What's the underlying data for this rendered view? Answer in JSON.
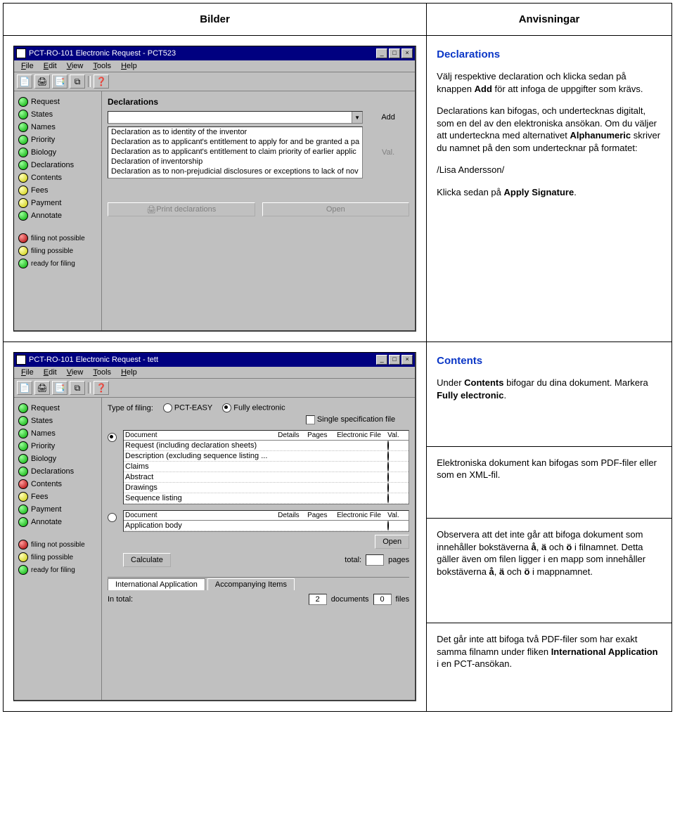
{
  "header": {
    "left": "Bilder",
    "right": "Anvisningar"
  },
  "screenshot1": {
    "title": "PCT-RO-101 Electronic Request - PCT523",
    "menu": [
      "File",
      "Edit",
      "View",
      "Tools",
      "Help"
    ],
    "toolbar_icons": [
      "new-icon",
      "open-icon",
      "print-icon",
      "duplicate-icon",
      "spacer",
      "help-icon"
    ],
    "sidebar": [
      {
        "color": "green",
        "label": "Request"
      },
      {
        "color": "green",
        "label": "States"
      },
      {
        "color": "green",
        "label": "Names"
      },
      {
        "color": "green",
        "label": "Priority"
      },
      {
        "color": "green",
        "label": "Biology"
      },
      {
        "color": "green",
        "label": "Declarations"
      },
      {
        "color": "yellow",
        "label": "Contents"
      },
      {
        "color": "yellow",
        "label": "Fees"
      },
      {
        "color": "yellow",
        "label": "Payment"
      },
      {
        "color": "green",
        "label": "Annotate"
      }
    ],
    "legend": [
      {
        "color": "red",
        "label": "filing not possible"
      },
      {
        "color": "yellow",
        "label": "filing possible"
      },
      {
        "color": "green",
        "label": "ready for filing"
      }
    ],
    "pane_title": "Declarations",
    "combo_value": "",
    "add_btn": "Add",
    "val_btn": "Val.",
    "decl_list": [
      "Declaration as to identity of the inventor",
      "Declaration as to applicant's entitlement to apply for and be granted a pa",
      "Declaration as to applicant's entitlement to claim priority of earlier applic",
      "Declaration of inventorship",
      "Declaration as to non-prejudicial disclosures or exceptions to lack of nov"
    ],
    "print_btn": "Print declarations",
    "open_btn": "Open"
  },
  "instr1": {
    "title": "Declarations",
    "p1a": "Välj respektive declaration och klicka sedan på knappen ",
    "p1b": "Add",
    "p1c": " för att infoga de uppgifter som krävs.",
    "p2a": "Declarations kan bifogas, och undertecknas digitalt, som en del av den elektroniska ansökan. Om du väljer att underteckna med alternativet ",
    "p2b": "Alphanumeric",
    "p2c": " skriver du namnet på den som undertecknar på formatet:",
    "sig": "/Lisa Andersson/",
    "p3a": "Klicka sedan på ",
    "p3b": "Apply Signature",
    "p3c": "."
  },
  "screenshot2": {
    "title": "PCT-RO-101 Electronic Request - tett",
    "menu": [
      "File",
      "Edit",
      "View",
      "Tools",
      "Help"
    ],
    "sidebar": [
      {
        "color": "green",
        "label": "Request"
      },
      {
        "color": "green",
        "label": "States"
      },
      {
        "color": "green",
        "label": "Names"
      },
      {
        "color": "green",
        "label": "Priority"
      },
      {
        "color": "green",
        "label": "Biology"
      },
      {
        "color": "green",
        "label": "Declarations"
      },
      {
        "color": "red",
        "label": "Contents"
      },
      {
        "color": "yellow",
        "label": "Fees"
      },
      {
        "color": "green",
        "label": "Payment"
      },
      {
        "color": "green",
        "label": "Annotate"
      }
    ],
    "legend": [
      {
        "color": "red",
        "label": "filing not possible"
      },
      {
        "color": "yellow",
        "label": "filing possible"
      },
      {
        "color": "green",
        "label": "ready for filing"
      }
    ],
    "filing_type_label": "Type of filing:",
    "filing_pcteasy": "PCT-EASY",
    "filing_fully": "Fully electronic",
    "single_spec": "Single specification file",
    "headers": [
      "Document",
      "Details",
      "Pages",
      "Electronic File",
      "Val."
    ],
    "docs1": [
      {
        "name": "Request (including declaration sheets)",
        "val": "green"
      },
      {
        "name": "Description (excluding sequence listing ...",
        "val": "red"
      },
      {
        "name": "Claims",
        "val": "red"
      },
      {
        "name": "Abstract",
        "val": "yellow"
      },
      {
        "name": "Drawings",
        "val": "grey"
      },
      {
        "name": "Sequence listing",
        "val": "grey"
      }
    ],
    "docs2": [
      {
        "name": "Application body",
        "val": "red"
      }
    ],
    "open_btn": "Open",
    "calculate_btn": "Calculate",
    "total_label": "total:",
    "pages_label": "pages",
    "tab1": "International Application",
    "tab2": "Accompanying Items",
    "intotal_label": "In total:",
    "doc_count": "2",
    "documents_label": "documents",
    "file_count": "0",
    "files_label": "files"
  },
  "instr2": {
    "block1_title": "Contents",
    "block1_p1a": "Under ",
    "block1_p1b": "Contents",
    "block1_p1c": " bifogar du dina dokument. Markera ",
    "block1_p1d": "Fully electronic",
    "block1_p1e": ".",
    "block2_p": "Elektroniska dokument kan bifogas som PDF-filer eller som en XML-fil.",
    "block3_p1a": "Observera att det inte går att bifoga dokument som innehåller bokstäverna ",
    "block3_aa": "å",
    "block3_c1": ", ",
    "block3_ae": "ä",
    "block3_c2": " och ",
    "block3_oe": "ö",
    "block3_p1b": " i filnamnet. Detta gäller även om filen ligger i en mapp som innehåller bokstäverna ",
    "block3_p1c": " i mappnamnet.",
    "block4_p1a": "Det går inte att bifoga två PDF-filer som har exakt samma filnamn under fliken ",
    "block4_b": "International Application",
    "block4_p1b": " i en PCT-ansökan."
  }
}
